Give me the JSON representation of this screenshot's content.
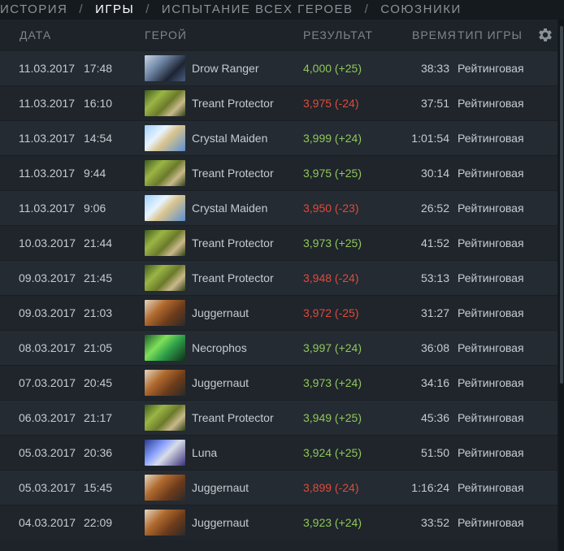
{
  "nav": {
    "tabs": [
      {
        "label": "ИСТОРИЯ"
      },
      {
        "label": "ИГРЫ"
      },
      {
        "label": "ИСПЫТАНИЕ ВСЕХ ГЕРОЕВ"
      },
      {
        "label": "СОЮЗНИКИ"
      }
    ],
    "separator": "/"
  },
  "table": {
    "headers": {
      "date": "ДАТА",
      "hero": "ГЕРОЙ",
      "result": "РЕЗУЛЬТАТ",
      "duration": "ВРЕМЯ",
      "game_type": "ТИП ИГРЫ"
    },
    "settings_icon": "gear-icon",
    "rows": [
      {
        "date": "11.03.2017",
        "time": "17:48",
        "hero": "Drow Ranger",
        "result": "4,000 (+25)",
        "outcome": "win",
        "duration": "38:33",
        "game_type": "Рейтинговая",
        "portrait": "drow"
      },
      {
        "date": "11.03.2017",
        "time": "16:10",
        "hero": "Treant Protector",
        "result": "3,975 (-24)",
        "outcome": "loss",
        "duration": "37:51",
        "game_type": "Рейтинговая",
        "portrait": "treant"
      },
      {
        "date": "11.03.2017",
        "time": "14:54",
        "hero": "Crystal Maiden",
        "result": "3,999 (+24)",
        "outcome": "win",
        "duration": "1:01:54",
        "game_type": "Рейтинговая",
        "portrait": "cm"
      },
      {
        "date": "11.03.2017",
        "time": "9:44",
        "hero": "Treant Protector",
        "result": "3,975 (+25)",
        "outcome": "win",
        "duration": "30:14",
        "game_type": "Рейтинговая",
        "portrait": "treant"
      },
      {
        "date": "11.03.2017",
        "time": "9:06",
        "hero": "Crystal Maiden",
        "result": "3,950 (-23)",
        "outcome": "loss",
        "duration": "26:52",
        "game_type": "Рейтинговая",
        "portrait": "cm"
      },
      {
        "date": "10.03.2017",
        "time": "21:44",
        "hero": "Treant Protector",
        "result": "3,973 (+25)",
        "outcome": "win",
        "duration": "41:52",
        "game_type": "Рейтинговая",
        "portrait": "treant"
      },
      {
        "date": "09.03.2017",
        "time": "21:45",
        "hero": "Treant Protector",
        "result": "3,948 (-24)",
        "outcome": "loss",
        "duration": "53:13",
        "game_type": "Рейтинговая",
        "portrait": "treant"
      },
      {
        "date": "09.03.2017",
        "time": "21:03",
        "hero": "Juggernaut",
        "result": "3,972 (-25)",
        "outcome": "loss",
        "duration": "31:27",
        "game_type": "Рейтинговая",
        "portrait": "jugg"
      },
      {
        "date": "08.03.2017",
        "time": "21:05",
        "hero": "Necrophos",
        "result": "3,997 (+24)",
        "outcome": "win",
        "duration": "36:08",
        "game_type": "Рейтинговая",
        "portrait": "necro"
      },
      {
        "date": "07.03.2017",
        "time": "20:45",
        "hero": "Juggernaut",
        "result": "3,973 (+24)",
        "outcome": "win",
        "duration": "34:16",
        "game_type": "Рейтинговая",
        "portrait": "jugg"
      },
      {
        "date": "06.03.2017",
        "time": "21:17",
        "hero": "Treant Protector",
        "result": "3,949 (+25)",
        "outcome": "win",
        "duration": "45:36",
        "game_type": "Рейтинговая",
        "portrait": "treant"
      },
      {
        "date": "05.03.2017",
        "time": "20:36",
        "hero": "Luna",
        "result": "3,924 (+25)",
        "outcome": "win",
        "duration": "51:50",
        "game_type": "Рейтинговая",
        "portrait": "luna"
      },
      {
        "date": "05.03.2017",
        "time": "15:45",
        "hero": "Juggernaut",
        "result": "3,899 (-24)",
        "outcome": "loss",
        "duration": "1:16:24",
        "game_type": "Рейтинговая",
        "portrait": "jugg"
      },
      {
        "date": "04.03.2017",
        "time": "22:09",
        "hero": "Juggernaut",
        "result": "3,923 (+24)",
        "outcome": "win",
        "duration": "33:52",
        "game_type": "Рейтинговая",
        "portrait": "jugg"
      }
    ]
  },
  "colors": {
    "win": "#8fc75a",
    "loss": "#e04a3c",
    "active_tab": "#ffffff"
  }
}
